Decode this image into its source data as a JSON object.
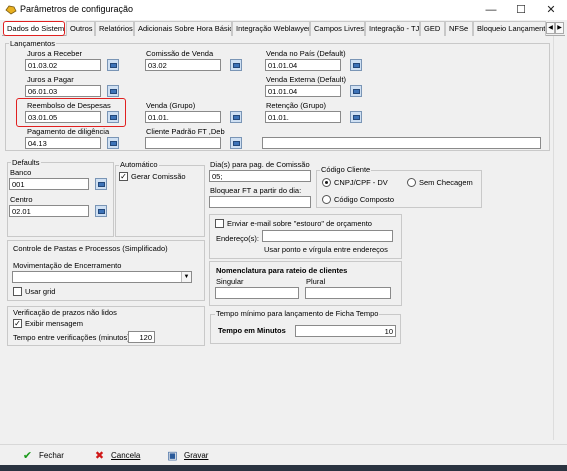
{
  "window": {
    "title": "Parâmetros de configuração",
    "minimize": "—",
    "maximize": "☐",
    "close": "✕"
  },
  "tabs": [
    "Dados do Sistema",
    "Outros",
    "Relatórios",
    "Adicionais Sobre Hora Básica",
    "Integração Weblawyer",
    "Campos Livres",
    "Integração - TJ",
    "GED",
    "NFSe",
    "Bloqueio Lançament..."
  ],
  "lancamentos": {
    "title": "Lançamentos",
    "juros_receber": {
      "label": "Juros a Receber",
      "value": "01.03.02"
    },
    "juros_pagar": {
      "label": "Juros a Pagar",
      "value": "06.01.03"
    },
    "reembolso": {
      "label": "Reembolso de Despesas",
      "value": "03.01.05"
    },
    "pagamento": {
      "label": "Pagamento de diligência",
      "value": "04.13"
    },
    "comissao_venda": {
      "label": "Comissão de Venda",
      "value": "03.02"
    },
    "venda_grupo": {
      "label": "Venda (Grupo)",
      "value": "01.01."
    },
    "cliente_padrao": {
      "label": "Cliente Padrão FT ,Deb",
      "value": ""
    },
    "venda_pais": {
      "label": "Venda no País (Default)",
      "value": "01.01.04"
    },
    "venda_externa": {
      "label": "Venda Externa (Default)",
      "value": "01.01.04"
    },
    "retencao": {
      "label": "Retenção (Grupo)",
      "value": "01.01."
    },
    "extra": ""
  },
  "defaults": {
    "title": "Defaults",
    "banco_label": "Banco",
    "banco": "001",
    "centro_label": "Centro",
    "centro": "02.01"
  },
  "automatico": {
    "title": "Automático",
    "gerar_comissao": "Gerar Comissão",
    "gerar_checked": "✓"
  },
  "dias": {
    "label": "Dia(s) para pag. de Comissão",
    "value": "05;",
    "bloquear_label": "Bloquear FT a partir do dia:",
    "bloquear_value": ""
  },
  "codigo_cliente": {
    "title": "Código Cliente",
    "opt1": "CNPJ/CPF - DV",
    "opt2": "Sem Checagem",
    "opt3": "Código Composto"
  },
  "email": {
    "label": "Enviar e-mail sobre \"estouro\" de orçamento",
    "endereco_label": "Endereço(s):",
    "endereco": "",
    "hint": "Usar ponto e vírgula entre endereços"
  },
  "pastas": {
    "title": "Controle de Pastas e Processos (Simplificado)",
    "mov_label": "Movimentação de Encerramento",
    "mov_value": "",
    "usar_grid": "Usar grid"
  },
  "nomenclatura": {
    "title": "Nomenclatura para rateio de clientes",
    "singular_label": "Singular",
    "singular": "",
    "plural_label": "Plural",
    "plural": ""
  },
  "prazos": {
    "title": "Verificação de prazos não lidos",
    "exibir": "Exibir mensagem",
    "exibir_checked": "✓",
    "tempo_label": "Tempo entre verificações (minutos):",
    "tempo": "120"
  },
  "tempo_ficha": {
    "title": "Tempo mínimo para lançamento de Ficha Tempo",
    "label": "Tempo em Minutos",
    "value": "10"
  },
  "buttons": {
    "fechar": "Fechar",
    "cancelar": "Cancela",
    "gravar": "Gravar"
  },
  "colors": {
    "accent": "#e02020",
    "lookup": "#3d73b8"
  }
}
